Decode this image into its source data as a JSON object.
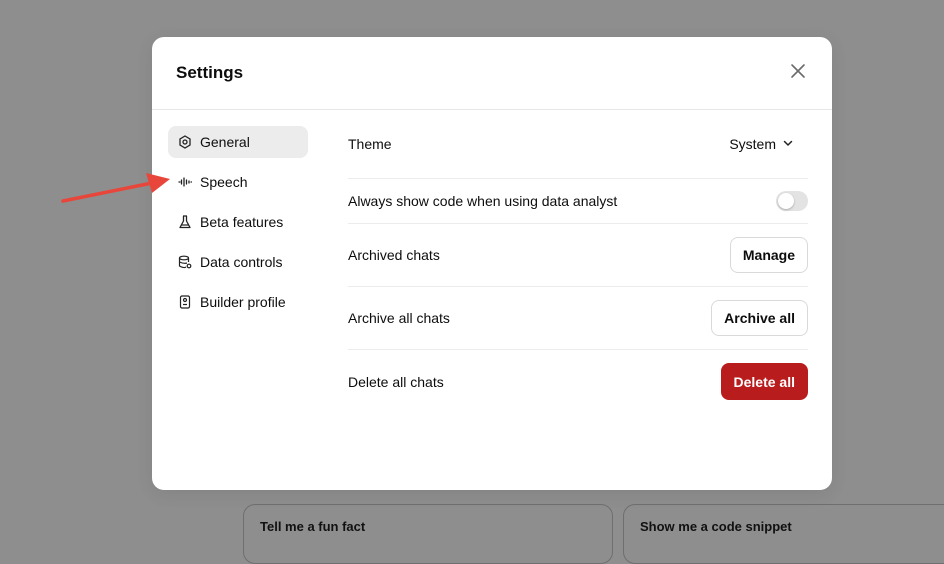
{
  "background_cards": [
    {
      "label": "Tell me a fun fact"
    },
    {
      "label": "Show me a code snippet"
    }
  ],
  "modal": {
    "title": "Settings",
    "close_icon": "close-icon"
  },
  "sidebar": {
    "items": [
      {
        "label": "General",
        "icon": "gear-icon",
        "active": true
      },
      {
        "label": "Speech",
        "icon": "waveform-icon",
        "active": false
      },
      {
        "label": "Beta features",
        "icon": "flask-icon",
        "active": false
      },
      {
        "label": "Data controls",
        "icon": "database-gear-icon",
        "active": false
      },
      {
        "label": "Builder profile",
        "icon": "id-badge-icon",
        "active": false
      }
    ]
  },
  "settings": {
    "theme": {
      "label": "Theme",
      "value": "System"
    },
    "code_toggle": {
      "label": "Always show code when using data analyst",
      "enabled": false
    },
    "archived": {
      "label": "Archived chats",
      "button": "Manage"
    },
    "archive_all": {
      "label": "Archive all chats",
      "button": "Archive all"
    },
    "delete_all": {
      "label": "Delete all chats",
      "button": "Delete all"
    }
  },
  "annotation": {
    "type": "red-arrow",
    "color": "#e8463a",
    "points_to": "Speech"
  },
  "colors": {
    "danger": "#b91c1c",
    "overlay": "#8e8e8e",
    "active_nav": "#ececec"
  }
}
